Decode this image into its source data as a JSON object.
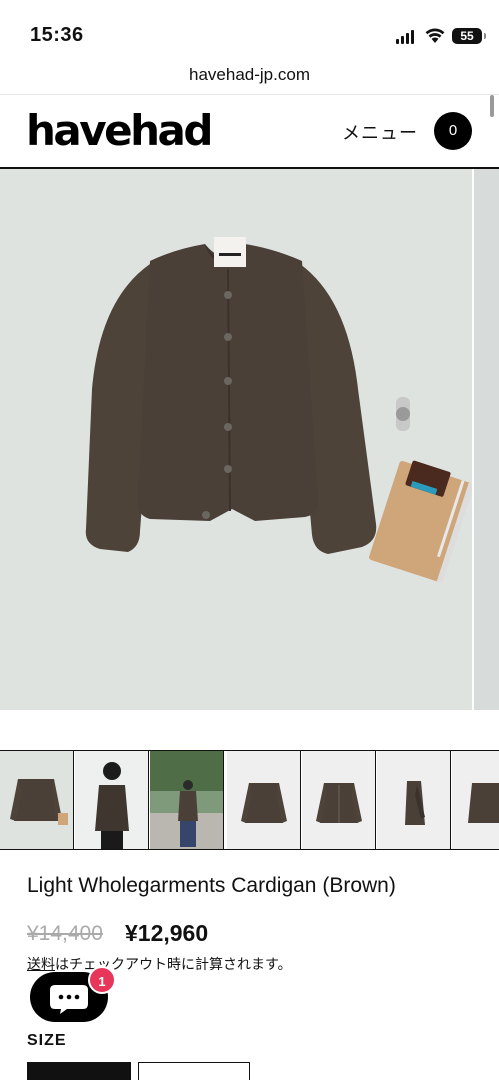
{
  "status_bar": {
    "time": "15:36",
    "battery": "55"
  },
  "browser": {
    "url": "havehad-jp.com"
  },
  "header": {
    "logo": "havehad",
    "menu_label": "メニュー",
    "cart_count": "0"
  },
  "product": {
    "title": "Light Wholegarments Cardigan (Brown)",
    "price_original": "¥14,400",
    "price_sale": "¥12,960",
    "shipping_link": "送料",
    "shipping_note": "はチェックアウト時に計算されます。",
    "size_label": "SIZE"
  },
  "chat": {
    "badge_count": "1"
  },
  "icons": {
    "signal": "signal-icon",
    "wifi": "wifi-icon",
    "battery": "battery-icon",
    "chat": "chat-bubble-icon"
  },
  "colors": {
    "hero_bg": "#dfe3e0",
    "cardigan": "#4a4038",
    "badge": "#e8365a"
  }
}
